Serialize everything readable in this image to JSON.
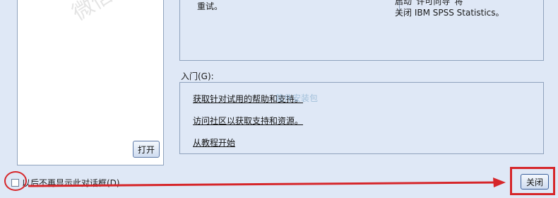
{
  "left_panel": {
    "open_button": "打开"
  },
  "top_panel": {
    "left_text": "重试。",
    "right_line1": "启动“许可向导”将",
    "right_line2": "关闭 IBM SPSS Statistics。"
  },
  "getting_started": {
    "label": "入门(G):",
    "links": [
      "获取针对试用的帮助和支持。",
      "访问社区以获取支持和资源。",
      "从教程开始"
    ]
  },
  "footer": {
    "dont_show_label": "以后不再显示此对话框(D)",
    "close_button": "关闭"
  },
  "watermark": "微信公众",
  "watermark_small": "软件安装包",
  "colors": {
    "annotation_red": "#d6262a",
    "background": "#dfe8f6"
  }
}
